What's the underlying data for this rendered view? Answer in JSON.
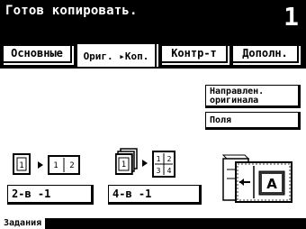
{
  "header": {
    "status": "Готов копировать.",
    "copy_count": "1"
  },
  "tabs": [
    {
      "label": "Основные"
    },
    {
      "label": "Ориг. ▸Коп."
    },
    {
      "label": "Контр-т"
    },
    {
      "label": "Дополн."
    }
  ],
  "options": {
    "orientation_label": "Направлен.\nоригинала",
    "margin_label": "Поля",
    "combine2_label": "2-в -1",
    "combine4_label": "4-в -1"
  },
  "combine_icons": {
    "combine2": {
      "source_pages": [
        "1"
      ],
      "target_pages": [
        "1",
        "2"
      ]
    },
    "combine4": {
      "source_pages": [
        "1"
      ],
      "target_pages": [
        "1",
        "2",
        "3",
        "4"
      ]
    }
  },
  "preview": {
    "letter": "A"
  },
  "footer": {
    "tab_label": "Задания"
  }
}
